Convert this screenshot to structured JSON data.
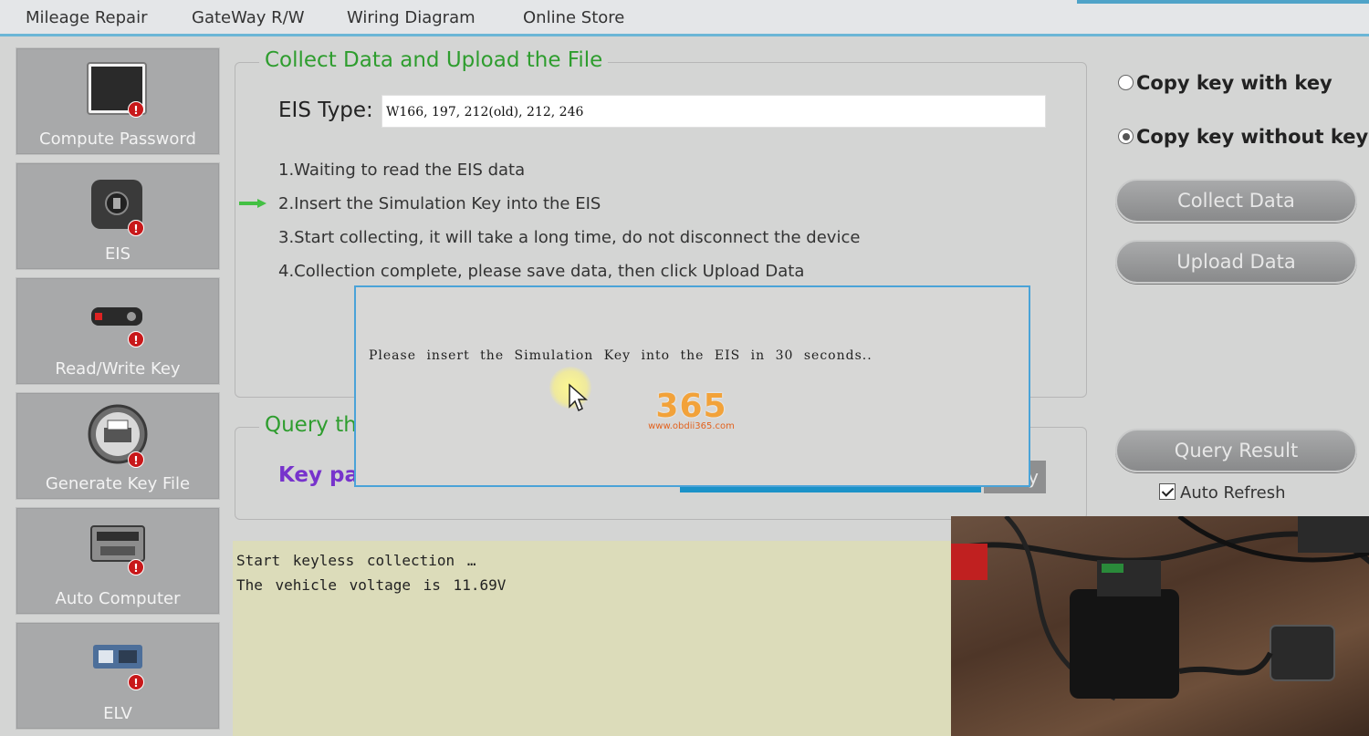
{
  "menu": {
    "items": [
      "Mileage Repair",
      "GateWay R/W",
      "Wiring Diagram",
      "Online Store"
    ]
  },
  "sidebar": {
    "items": [
      {
        "label": "Compute Password",
        "icon": "monitor-icon",
        "badge": "!"
      },
      {
        "label": "EIS",
        "icon": "ignition-switch-icon",
        "badge": "!"
      },
      {
        "label": "Read/Write Key",
        "icon": "car-key-icon",
        "badge": "!"
      },
      {
        "label": "Generate Key File",
        "icon": "printer-icon",
        "badge": "!"
      },
      {
        "label": "Auto Computer",
        "icon": "ecu-module-icon",
        "badge": "!"
      },
      {
        "label": "ELV",
        "icon": "steering-lock-icon",
        "badge": "!"
      }
    ]
  },
  "collect": {
    "title": "Collect Data and Upload the File",
    "eis_label": "EIS Type:",
    "eis_value": "W166, 197, 212(old), 212, 246",
    "steps": [
      "1.Waiting to read the EIS data",
      "2.Insert the Simulation Key into the EIS",
      "3.Start collecting, it will take a long time, do not disconnect the device",
      "4.Collection complete, please save data, then click Upload Data"
    ],
    "current_step": 2
  },
  "query": {
    "title": "Query th",
    "key_label": "Key pa",
    "button_fragment": "y"
  },
  "options": {
    "copy_with_key": "Copy key with key",
    "copy_without_key": "Copy key without key",
    "selected": "copy_without_key"
  },
  "buttons": {
    "collect": "Collect Data",
    "upload": "Upload  Data",
    "query": "Query Result"
  },
  "auto_refresh": {
    "label": "Auto Refresh",
    "checked": true
  },
  "log": {
    "lines": [
      "Start keyless collection …",
      "The vehicle voltage is 11.69V"
    ]
  },
  "dialog": {
    "message": "Please insert the Simulation Key into the EIS in 30 seconds.."
  },
  "watermark": {
    "digits": "365",
    "url": "www.obdii365.com"
  }
}
